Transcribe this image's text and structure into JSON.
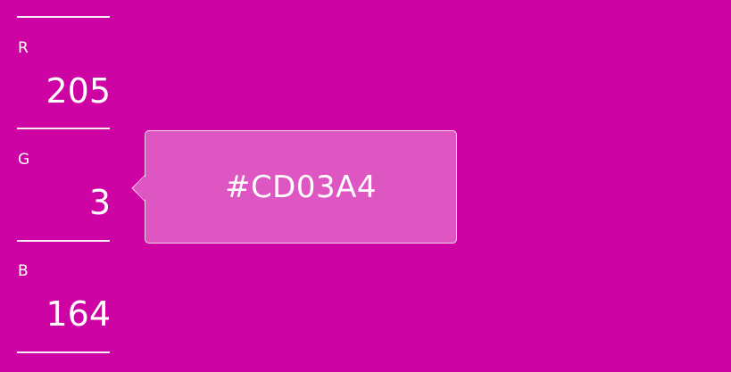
{
  "theme": {
    "background": "#CD03A4",
    "tooltip_fill": "#DD56C1",
    "text": "#FFFFFF"
  },
  "channels": [
    {
      "label": "R",
      "value": "205"
    },
    {
      "label": "G",
      "value": "3"
    },
    {
      "label": "B",
      "value": "164"
    }
  ],
  "tooltip": {
    "hex": "#CD03A4"
  }
}
